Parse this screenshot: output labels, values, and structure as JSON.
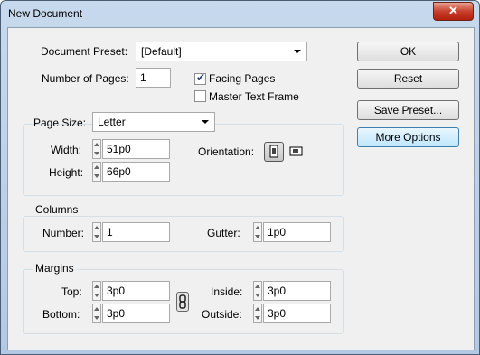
{
  "window": {
    "title": "New Document",
    "close_glyph": "✕"
  },
  "document_preset": {
    "label": "Document Preset:",
    "value": "[Default]"
  },
  "pages": {
    "label": "Number of Pages:",
    "value": "1"
  },
  "facing_pages": {
    "label": "Facing Pages",
    "checked": true
  },
  "master_text_frame": {
    "label": "Master Text Frame",
    "checked": false
  },
  "page_size": {
    "label": "Page Size:",
    "value": "Letter",
    "width_label": "Width:",
    "width_value": "51p0",
    "height_label": "Height:",
    "height_value": "66p0",
    "orientation_label": "Orientation:",
    "orientation_selected": "portrait"
  },
  "columns": {
    "title": "Columns",
    "number_label": "Number:",
    "number_value": "1",
    "gutter_label": "Gutter:",
    "gutter_value": "1p0"
  },
  "margins": {
    "title": "Margins",
    "top_label": "Top:",
    "top_value": "3p0",
    "bottom_label": "Bottom:",
    "bottom_value": "3p0",
    "inside_label": "Inside:",
    "inside_value": "3p0",
    "outside_label": "Outside:",
    "outside_value": "3p0"
  },
  "buttons": {
    "ok": "OK",
    "reset": "Reset",
    "save_preset": "Save Preset...",
    "more_options": "More Options"
  }
}
